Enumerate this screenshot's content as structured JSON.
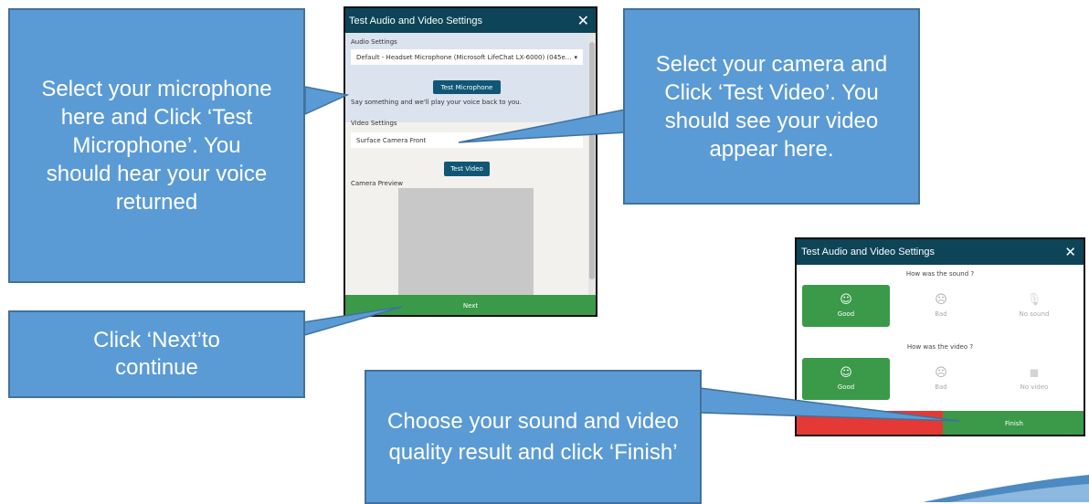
{
  "dialog1": {
    "title": "Test Audio and Video Settings",
    "close_glyph": "✕",
    "audio_label": "Audio Settings",
    "audio_device": "Default - Headset Microphone (Microsoft LifeChat LX-6000) (045e...",
    "dropdown_glyph": "▾",
    "test_mic_label": "Test Microphone",
    "mic_hint": "Say something and we'll play your voice back to you.",
    "video_label": "Video Settings",
    "video_device": "Surface Camera Front",
    "test_video_label": "Test Video",
    "preview_label": "Camera Preview",
    "next_label": "Next"
  },
  "dialog2": {
    "title": "Test Audio and Video Settings",
    "close_glyph": "✕",
    "sound_question": "How was the sound ?",
    "video_question": "How was the video ?",
    "sound_options": [
      {
        "label": "Good",
        "icon": "smile-icon",
        "glyph": "☺"
      },
      {
        "label": "Bad",
        "icon": "frown-icon",
        "glyph": "☹"
      },
      {
        "label": "No sound",
        "icon": "mic-off-icon",
        "glyph": "🎙"
      }
    ],
    "video_options": [
      {
        "label": "Good",
        "icon": "smile-icon",
        "glyph": "☺"
      },
      {
        "label": "Bad",
        "icon": "frown-icon",
        "glyph": "☹"
      },
      {
        "label": "No video",
        "icon": "video-off-icon",
        "glyph": "◼"
      }
    ],
    "finish_label": "Finish"
  },
  "callouts": {
    "mic": "Select your microphone here and Click ‘Test Microphone’. You should hear your voice returned",
    "camera": "Select your camera and Click ‘Test Video’. You should see your video appear here.",
    "next": "Click ‘Next’to continue",
    "finish": "Choose your sound and video quality result and click ‘Finish’"
  },
  "colors": {
    "callout_fill": "#5b9bd5",
    "header": "#0d4458",
    "button_blue": "#0f5774",
    "green": "#3a9a49",
    "red": "#e53935"
  }
}
